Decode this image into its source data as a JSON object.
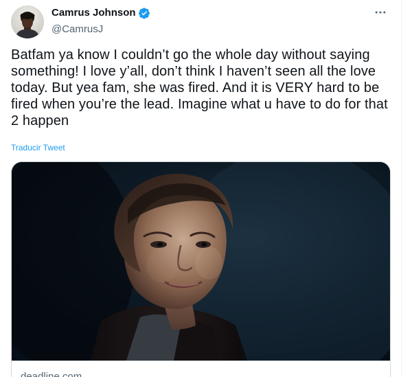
{
  "tweet": {
    "author": {
      "display_name": "Camrus Johnson",
      "handle": "@CamrusJ",
      "verified": true,
      "avatar_icon": "profile-photo"
    },
    "more_icon": "ellipsis-icon",
    "text": "Batfam ya know I couldn’t go the whole day without saying something! I love y’all, don’t think I haven’t seen all the love today. But yea fam, she was fired. And it is VERY hard to be fired when you’re the lead. Imagine what u have to do for that 2 happen",
    "translate_label": "Traducir Tweet",
    "link_card": {
      "domain": "deadline.com",
      "image_description_icon": "portrait-photo"
    }
  },
  "colors": {
    "text_primary": "#0f1419",
    "text_secondary": "#536471",
    "link": "#1d9bf0",
    "border": "#cfd9de",
    "verified": "#1d9bf0"
  }
}
